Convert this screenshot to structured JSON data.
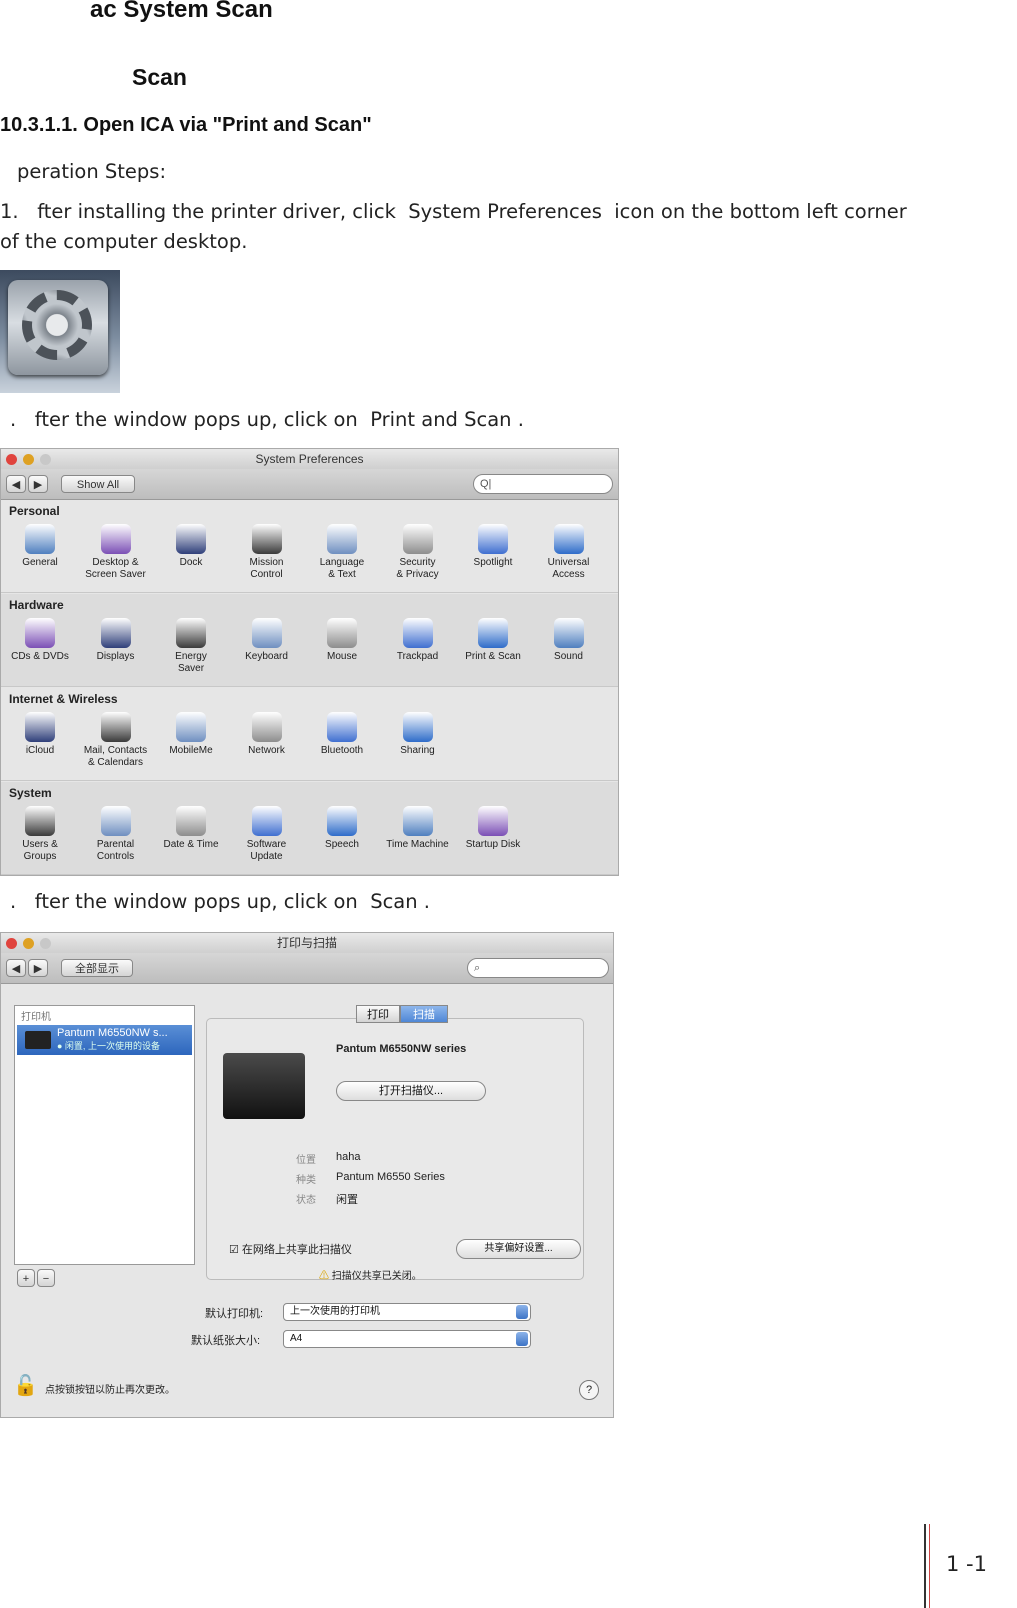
{
  "headings": {
    "main": "ac System Scan",
    "sub": "Scan",
    "section": "10.3.1.1. Open ICA via \"Print and Scan\""
  },
  "body": {
    "op_steps": "peration Steps:",
    "step1_line1": "1.   fter installing the printer driver, click  System Preferences  icon on the bottom left corner",
    "step1_line2": "of the computer desktop.",
    "step2": ".   fter the window pops up, click on  Print and Scan .",
    "step3": ".   fter the window pops up, click on  Scan ."
  },
  "syspref": {
    "title": "System Preferences",
    "show_all": "Show All",
    "search_value": "Q|",
    "sections": [
      {
        "title": "Personal",
        "items": [
          "General",
          "Desktop &\nScreen Saver",
          "Dock",
          "Mission\nControl",
          "Language\n& Text",
          "Security\n& Privacy",
          "Spotlight",
          "Universal\nAccess"
        ]
      },
      {
        "title": "Hardware",
        "items": [
          "CDs & DVDs",
          "Displays",
          "Energy\nSaver",
          "Keyboard",
          "Mouse",
          "Trackpad",
          "Print & Scan",
          "Sound"
        ]
      },
      {
        "title": "Internet & Wireless",
        "items": [
          "iCloud",
          "Mail, Contacts\n& Calendars",
          "MobileMe",
          "Network",
          "Bluetooth",
          "Sharing"
        ]
      },
      {
        "title": "System",
        "items": [
          "Users &\nGroups",
          "Parental\nControls",
          "Date & Time",
          "Software\nUpdate",
          "Speech",
          "Time Machine",
          "Startup Disk"
        ]
      }
    ]
  },
  "printscan": {
    "title": "打印与扫描",
    "show_all": "全部显示",
    "list_header": "打印机",
    "printer_name": "Pantum M6550NW s...",
    "printer_status": "● 闲置, 上一次使用的设备",
    "tab_print": "打印",
    "tab_scan": "扫描",
    "model": "Pantum M6550NW series",
    "open_scanner": "打开扫描仪...",
    "location_label": "位置",
    "location_value": "haha",
    "kind_label": "种类",
    "kind_value": "Pantum M6550 Series",
    "status_label": "状态",
    "status_value": "闲置",
    "share_checkbox": "在网络上共享此扫描仪",
    "sharing_prefs": "共享偏好设置...",
    "share_off_note": "扫描仪共享已关闭。",
    "default_printer_label": "默认打印机:",
    "default_printer_value": "上一次使用的打印机",
    "default_paper_label": "默认纸张大小:",
    "default_paper_value": "A4",
    "lock_note": "点按锁按钮以防止再次更改。",
    "add_button": "+",
    "remove_button": "−",
    "help": "?"
  },
  "page_number": "1  -1",
  "colors": {
    "selection_blue": "#2d66bd",
    "window_bg": "#e6e6e6",
    "close_red": "#e0443e",
    "minimize_yellow": "#dea123",
    "zoom_green": "#1aab29"
  }
}
